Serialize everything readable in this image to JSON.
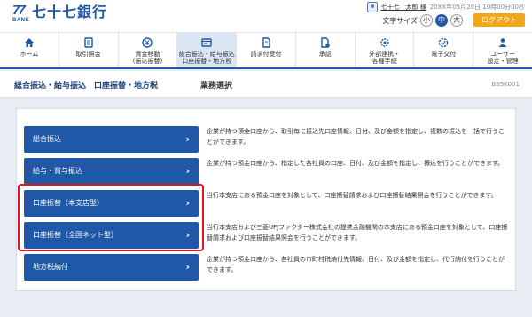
{
  "header": {
    "logo_num": "77",
    "logo_bank": "BANK",
    "bank_name": "七十七銀行",
    "user_name": "七十七　太郎 様",
    "datetime": "20XX年05月20日 10時00分00秒",
    "text_size_label": "文字サイズ",
    "size_small": "小",
    "size_medium": "中",
    "size_large": "大",
    "logout_label": "ログアウト"
  },
  "nav": {
    "items": [
      {
        "label": "ホーム",
        "icon": "home-icon"
      },
      {
        "label": "取引照会",
        "icon": "ledger-icon"
      },
      {
        "label": "資金移動\n(振込振替)",
        "icon": "yen-transfer-icon"
      },
      {
        "label": "総合振込・給与振込\n口座振替・地方税",
        "icon": "transfer-window-icon"
      },
      {
        "label": "請求付受付",
        "icon": "document-icon"
      },
      {
        "label": "承認",
        "icon": "approval-icon"
      },
      {
        "label": "外部連携・\n各種手続",
        "icon": "link-gear-icon"
      },
      {
        "label": "電子交付",
        "icon": "electronic-delivery-icon"
      },
      {
        "label": "ユーザー\n設定・管理",
        "icon": "user-settings-icon"
      }
    ]
  },
  "title_bar": {
    "title": "総合振込・給与振込　口座振替・地方税",
    "subtitle": "業務選択",
    "screen_id": "BSSK001"
  },
  "menu": [
    {
      "label": "総合振込",
      "description": "企業が持つ預金口座から、取引毎に振込先口座情報、日付、及び金額を指定し、複数の振込を一括で行うことができます。"
    },
    {
      "label": "給与・賞与振込",
      "description": "企業が持つ預金口座から、指定した各社員の口座、日付、及び金額を指定し、振込を行うことができます。"
    },
    {
      "label": "口座振替（本支店型）",
      "description": "当行本支店にある預金口座を対象として、口座振替請求および口座振替結果照会を行うことができます。"
    },
    {
      "label": "口座振替（全国ネット型）",
      "description": "当行本支店および三菱UFJファクター株式会社の提携金融機関の本支店にある預金口座を対象として、口座振替請求および口座振替結果照会を行うことができます。"
    },
    {
      "label": "地方税納付",
      "description": "企業が持つ預金口座から、各社員の市町村税納付先情報、日付、及び金額を指定し、代行納付を行うことができます。"
    }
  ],
  "colors": {
    "brand": "#1f58a6",
    "logout": "#f2a71b",
    "highlight": "#e6141e"
  }
}
